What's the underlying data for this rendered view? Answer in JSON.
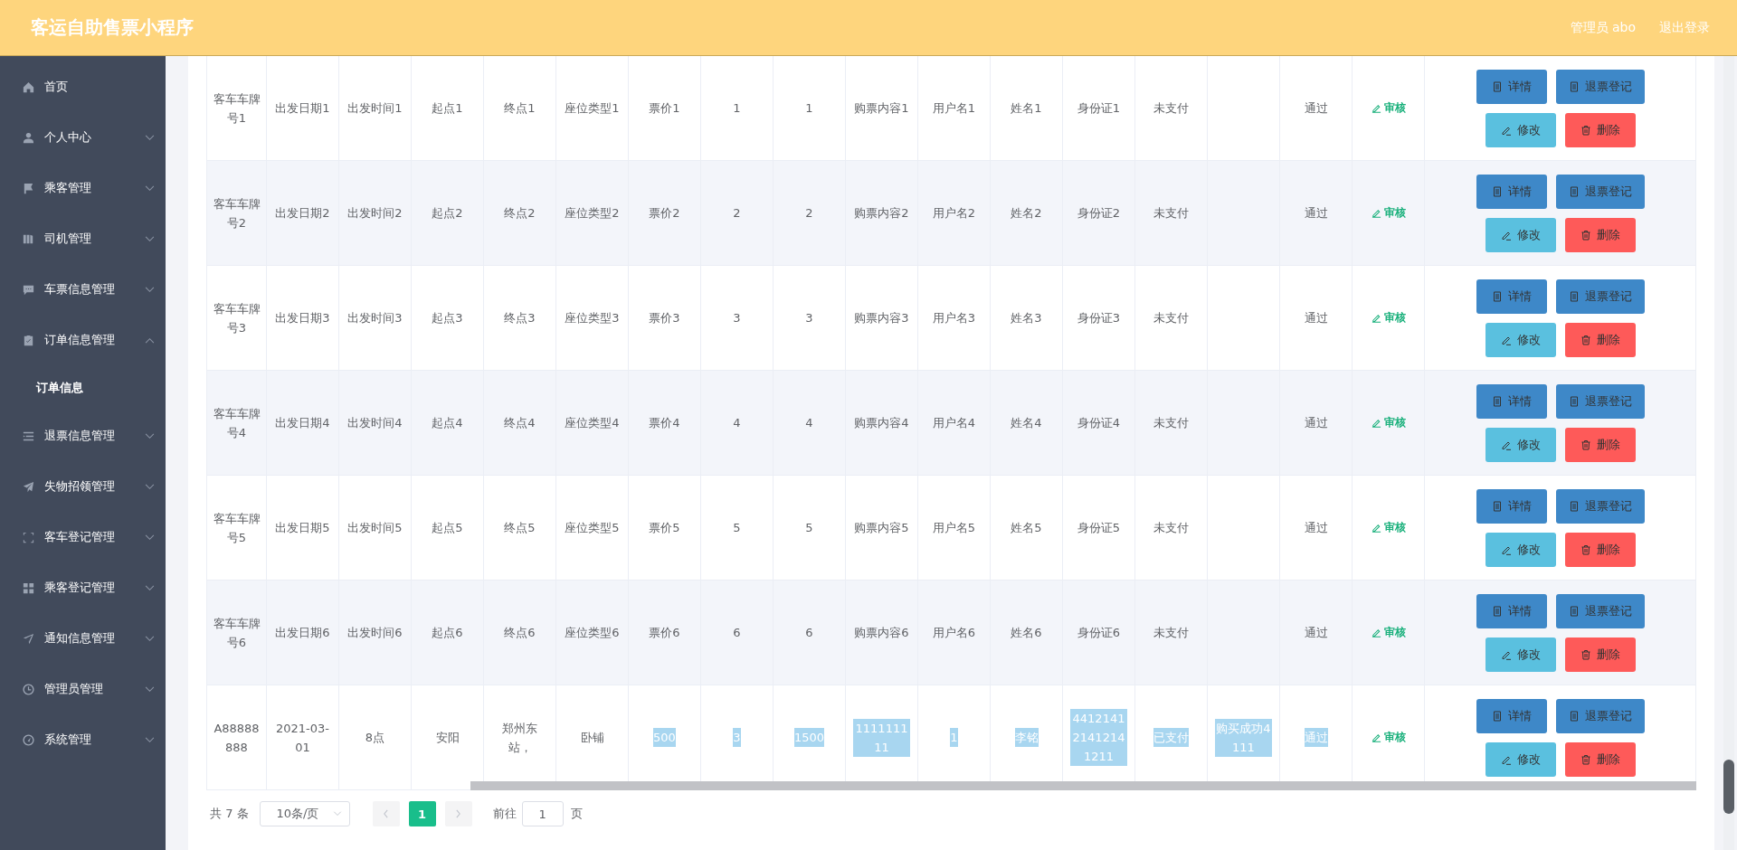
{
  "header": {
    "title": "客运自助售票小程序",
    "user": "管理员 abo",
    "logout": "退出登录"
  },
  "sidebar": {
    "items": [
      {
        "label": "首页"
      },
      {
        "label": "个人中心",
        "expanded": false
      },
      {
        "label": "乘客管理",
        "expanded": false
      },
      {
        "label": "司机管理",
        "expanded": false
      },
      {
        "label": "车票信息管理",
        "expanded": false
      },
      {
        "label": "订单信息管理",
        "expanded": true,
        "children": [
          {
            "label": "订单信息",
            "selected": true
          }
        ]
      },
      {
        "label": "退票信息管理",
        "expanded": false
      },
      {
        "label": "失物招领管理",
        "expanded": false
      },
      {
        "label": "客车登记管理",
        "expanded": false
      },
      {
        "label": "乘客登记管理",
        "expanded": false
      },
      {
        "label": "通知信息管理",
        "expanded": false
      },
      {
        "label": "管理员管理",
        "expanded": false
      },
      {
        "label": "系统管理",
        "expanded": false
      }
    ]
  },
  "table": {
    "rows": [
      {
        "cells": [
          {
            "text": "客车车牌号1",
            "highlighted": false
          },
          {
            "text": "出发日期1",
            "highlighted": false
          },
          {
            "text": "出发时间1",
            "highlighted": false
          },
          {
            "text": "起点1",
            "highlighted": false
          },
          {
            "text": "终点1",
            "highlighted": false
          },
          {
            "text": "座位类型1",
            "highlighted": false
          },
          {
            "text": "票价1",
            "highlighted": false
          },
          {
            "text": "1",
            "highlighted": false
          },
          {
            "text": "1",
            "highlighted": false
          },
          {
            "text": "购票内容1",
            "highlighted": false
          },
          {
            "text": "用户名1",
            "highlighted": false
          },
          {
            "text": "姓名1",
            "highlighted": false
          },
          {
            "text": "身份证1",
            "highlighted": false
          },
          {
            "text": "未支付",
            "highlighted": false
          },
          {},
          {
            "text": "通过",
            "highlighted": false
          }
        ],
        "review": "审核",
        "actions": [
          {
            "label": "详情",
            "kind": "detail"
          },
          {
            "label": "退票登记",
            "kind": "refund"
          },
          {
            "label": "修改",
            "kind": "edit"
          },
          {
            "label": "删除",
            "kind": "delete"
          }
        ]
      },
      {
        "cells": [
          {
            "text": "客车车牌号2",
            "highlighted": false
          },
          {
            "text": "出发日期2",
            "highlighted": false
          },
          {
            "text": "出发时间2",
            "highlighted": false
          },
          {
            "text": "起点2",
            "highlighted": false
          },
          {
            "text": "终点2",
            "highlighted": false
          },
          {
            "text": "座位类型2",
            "highlighted": false
          },
          {
            "text": "票价2",
            "highlighted": false
          },
          {
            "text": "2",
            "highlighted": false
          },
          {
            "text": "2",
            "highlighted": false
          },
          {
            "text": "购票内容2",
            "highlighted": false
          },
          {
            "text": "用户名2",
            "highlighted": false
          },
          {
            "text": "姓名2",
            "highlighted": false
          },
          {
            "text": "身份证2",
            "highlighted": false
          },
          {
            "text": "未支付",
            "highlighted": false
          },
          {},
          {
            "text": "通过",
            "highlighted": false
          }
        ],
        "review": "审核",
        "actions": [
          {
            "label": "详情",
            "kind": "detail"
          },
          {
            "label": "退票登记",
            "kind": "refund"
          },
          {
            "label": "修改",
            "kind": "edit"
          },
          {
            "label": "删除",
            "kind": "delete"
          }
        ]
      },
      {
        "cells": [
          {
            "text": "客车车牌号3",
            "highlighted": false
          },
          {
            "text": "出发日期3",
            "highlighted": false
          },
          {
            "text": "出发时间3",
            "highlighted": false
          },
          {
            "text": "起点3",
            "highlighted": false
          },
          {
            "text": "终点3",
            "highlighted": false
          },
          {
            "text": "座位类型3",
            "highlighted": false
          },
          {
            "text": "票价3",
            "highlighted": false
          },
          {
            "text": "3",
            "highlighted": false
          },
          {
            "text": "3",
            "highlighted": false
          },
          {
            "text": "购票内容3",
            "highlighted": false
          },
          {
            "text": "用户名3",
            "highlighted": false
          },
          {
            "text": "姓名3",
            "highlighted": false
          },
          {
            "text": "身份证3",
            "highlighted": false
          },
          {
            "text": "未支付",
            "highlighted": false
          },
          {},
          {
            "text": "通过",
            "highlighted": false
          }
        ],
        "review": "审核",
        "actions": [
          {
            "label": "详情",
            "kind": "detail"
          },
          {
            "label": "退票登记",
            "kind": "refund"
          },
          {
            "label": "修改",
            "kind": "edit"
          },
          {
            "label": "删除",
            "kind": "delete"
          }
        ]
      },
      {
        "cells": [
          {
            "text": "客车车牌号4",
            "highlighted": false
          },
          {
            "text": "出发日期4",
            "highlighted": false
          },
          {
            "text": "出发时间4",
            "highlighted": false
          },
          {
            "text": "起点4",
            "highlighted": false
          },
          {
            "text": "终点4",
            "highlighted": false
          },
          {
            "text": "座位类型4",
            "highlighted": false
          },
          {
            "text": "票价4",
            "highlighted": false
          },
          {
            "text": "4",
            "highlighted": false
          },
          {
            "text": "4",
            "highlighted": false
          },
          {
            "text": "购票内容4",
            "highlighted": false
          },
          {
            "text": "用户名4",
            "highlighted": false
          },
          {
            "text": "姓名4",
            "highlighted": false
          },
          {
            "text": "身份证4",
            "highlighted": false
          },
          {
            "text": "未支付",
            "highlighted": false
          },
          {},
          {
            "text": "通过",
            "highlighted": false
          }
        ],
        "review": "审核",
        "actions": [
          {
            "label": "详情",
            "kind": "detail"
          },
          {
            "label": "退票登记",
            "kind": "refund"
          },
          {
            "label": "修改",
            "kind": "edit"
          },
          {
            "label": "删除",
            "kind": "delete"
          }
        ]
      },
      {
        "cells": [
          {
            "text": "客车车牌号5",
            "highlighted": false
          },
          {
            "text": "出发日期5",
            "highlighted": false
          },
          {
            "text": "出发时间5",
            "highlighted": false
          },
          {
            "text": "起点5",
            "highlighted": false
          },
          {
            "text": "终点5",
            "highlighted": false
          },
          {
            "text": "座位类型5",
            "highlighted": false
          },
          {
            "text": "票价5",
            "highlighted": false
          },
          {
            "text": "5",
            "highlighted": false
          },
          {
            "text": "5",
            "highlighted": false
          },
          {
            "text": "购票内容5",
            "highlighted": false
          },
          {
            "text": "用户名5",
            "highlighted": false
          },
          {
            "text": "姓名5",
            "highlighted": false
          },
          {
            "text": "身份证5",
            "highlighted": false
          },
          {
            "text": "未支付",
            "highlighted": false
          },
          {},
          {
            "text": "通过",
            "highlighted": false
          }
        ],
        "review": "审核",
        "actions": [
          {
            "label": "详情",
            "kind": "detail"
          },
          {
            "label": "退票登记",
            "kind": "refund"
          },
          {
            "label": "修改",
            "kind": "edit"
          },
          {
            "label": "删除",
            "kind": "delete"
          }
        ]
      },
      {
        "cells": [
          {
            "text": "客车车牌号6",
            "highlighted": false
          },
          {
            "text": "出发日期6",
            "highlighted": false
          },
          {
            "text": "出发时间6",
            "highlighted": false
          },
          {
            "text": "起点6",
            "highlighted": false
          },
          {
            "text": "终点6",
            "highlighted": false
          },
          {
            "text": "座位类型6",
            "highlighted": false
          },
          {
            "text": "票价6",
            "highlighted": false
          },
          {
            "text": "6",
            "highlighted": false
          },
          {
            "text": "6",
            "highlighted": false
          },
          {
            "text": "购票内容6",
            "highlighted": false
          },
          {
            "text": "用户名6",
            "highlighted": false
          },
          {
            "text": "姓名6",
            "highlighted": false
          },
          {
            "text": "身份证6",
            "highlighted": false
          },
          {
            "text": "未支付",
            "highlighted": false
          },
          {},
          {
            "text": "通过",
            "highlighted": false
          }
        ],
        "review": "审核",
        "actions": [
          {
            "label": "详情",
            "kind": "detail"
          },
          {
            "label": "退票登记",
            "kind": "refund"
          },
          {
            "label": "修改",
            "kind": "edit"
          },
          {
            "label": "删除",
            "kind": "delete"
          }
        ]
      },
      {
        "cells": [
          {
            "text": "A88888888",
            "highlighted": false
          },
          {
            "text": "2021-03-01",
            "highlighted": false
          },
          {
            "text": "8点",
            "highlighted": false
          },
          {
            "text": "安阳",
            "highlighted": false
          },
          {
            "text": "郑州东站，",
            "highlighted": false
          },
          {
            "text": "卧铺",
            "highlighted": false
          },
          {
            "text": "500",
            "highlighted": true
          },
          {
            "text": "3",
            "highlighted": true
          },
          {
            "text": "1500",
            "highlighted": true
          },
          {
            "text": "111111111",
            "highlighted": true
          },
          {
            "text": "1",
            "highlighted": true
          },
          {
            "text": "李铭",
            "highlighted": true
          },
          {
            "text": "441214121412141211",
            "highlighted": true
          },
          {
            "text": "已支付",
            "highlighted": true
          },
          {
            "text": "购买成功4111",
            "highlighted": true
          },
          {
            "text": "通过",
            "highlighted": true
          }
        ],
        "review": "审核",
        "actions": [
          {
            "label": "详情",
            "kind": "detail"
          },
          {
            "label": "退票登记",
            "kind": "refund"
          },
          {
            "label": "修改",
            "kind": "edit"
          },
          {
            "label": "删除",
            "kind": "delete"
          }
        ]
      }
    ]
  },
  "pagination": {
    "total": "共 7 条",
    "page_size": "10条/页",
    "pages": [
      {
        "label": "1",
        "selected": true
      }
    ],
    "goto_label": "前往",
    "goto_value": "1",
    "goto_suffix": "页"
  }
}
